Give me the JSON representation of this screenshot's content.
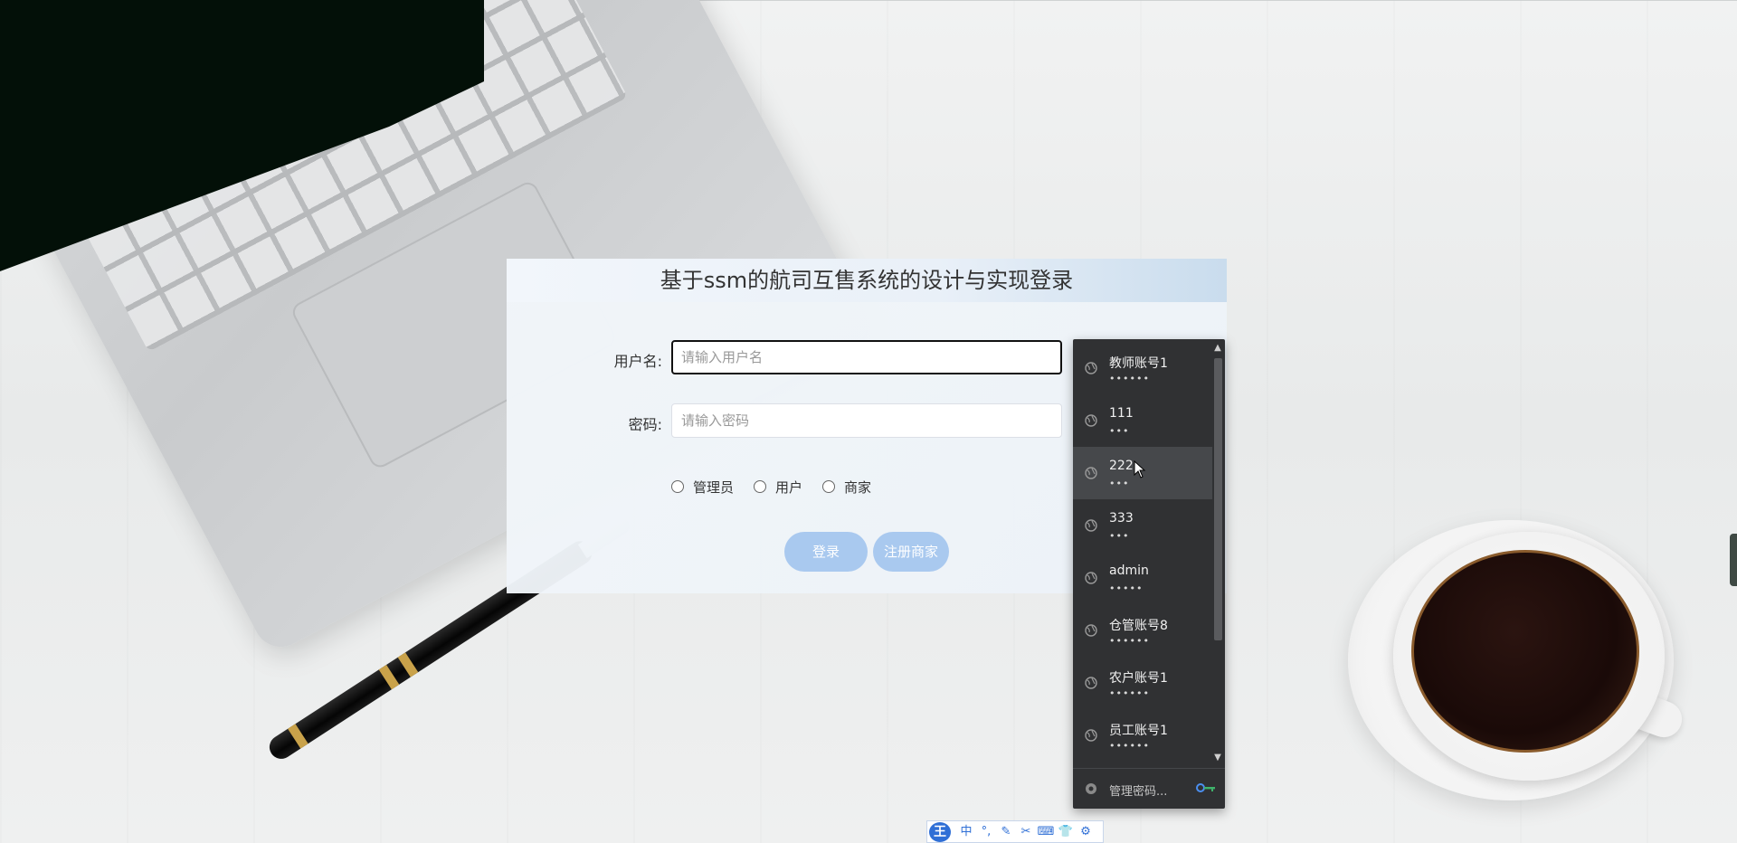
{
  "login": {
    "title": "基于ssm的航司互售系统的设计与实现登录",
    "username_label": "用户名:",
    "username_placeholder": "请输入用户名",
    "password_label": "密码:",
    "password_placeholder": "请输入密码",
    "roles": [
      "管理员",
      "用户",
      "商家"
    ],
    "login_button": "登录",
    "register_button": "注册商家"
  },
  "autofill": {
    "accounts": [
      {
        "user": "教师账号1",
        "pass": "••••••"
      },
      {
        "user": "111",
        "pass": "•••"
      },
      {
        "user": "222",
        "pass": "•••"
      },
      {
        "user": "333",
        "pass": "•••"
      },
      {
        "user": "admin",
        "pass": "•••••"
      },
      {
        "user": "仓管账号8",
        "pass": "••••••"
      },
      {
        "user": "农户账号1",
        "pass": "••••••"
      },
      {
        "user": "员工账号1",
        "pass": "••••••"
      }
    ],
    "hovered_index": 2,
    "manage_label": "管理密码...",
    "icon": "globe-icon",
    "scroll_up": "▲",
    "scroll_down": "▼"
  },
  "ime_toolbar": {
    "logo": "王",
    "items": [
      "中",
      "°,",
      "✎",
      "✂",
      "⌨",
      "👕",
      "⚙"
    ]
  },
  "colors": {
    "button_bg": "#a9c9ef",
    "dropdown_bg": "#303133",
    "dropdown_hover": "#46484b",
    "ime_accent": "#2f6fd6"
  }
}
